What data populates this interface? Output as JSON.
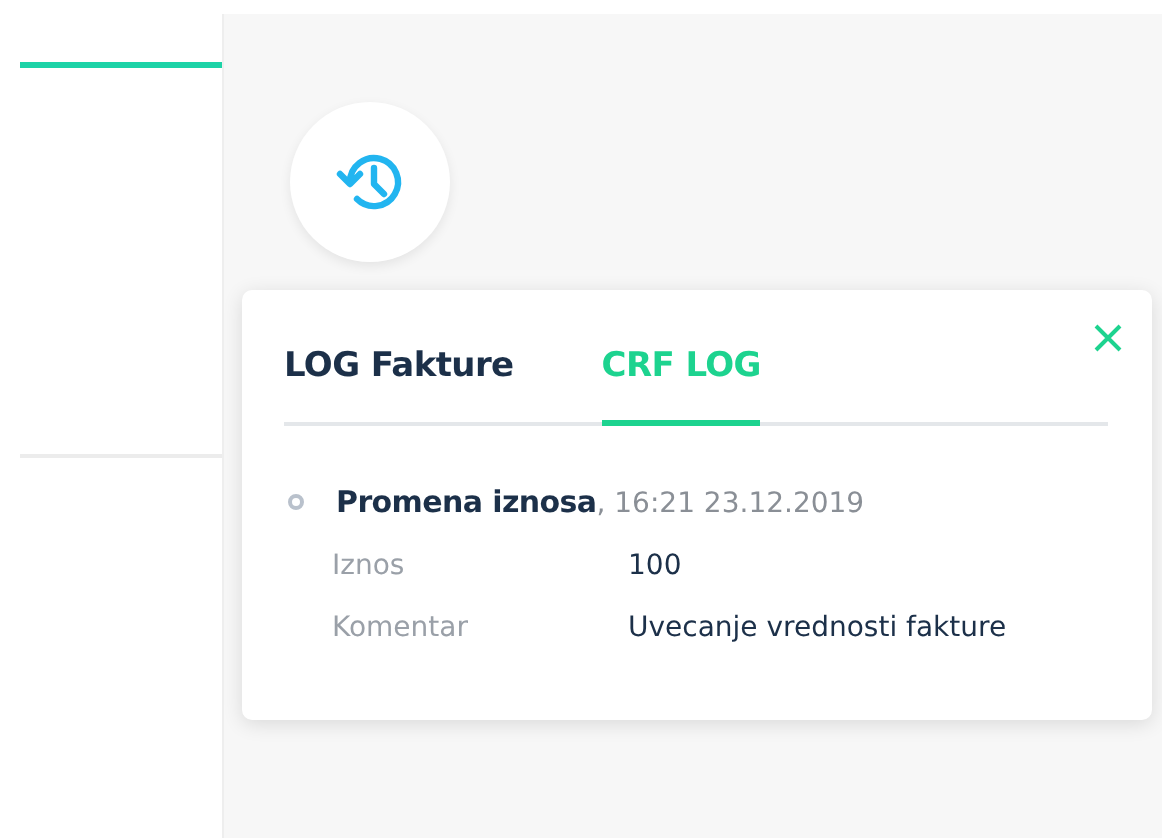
{
  "log_popup": {
    "tabs": [
      {
        "label": "LOG Fakture",
        "selected": false
      },
      {
        "label": "CRF LOG",
        "selected": true
      }
    ],
    "entries": [
      {
        "title": "Promena iznosa",
        "timestamp": ", 16:21 23.12.2019",
        "fields": [
          {
            "label": "Iznos",
            "value": "100"
          },
          {
            "label": "Komentar",
            "value": "Uvecanje vrednosti fakture"
          }
        ]
      }
    ]
  }
}
